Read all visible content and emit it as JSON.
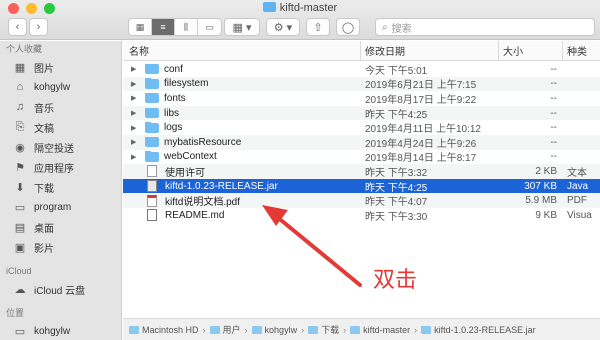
{
  "window": {
    "title": "kiftd-master"
  },
  "toolbar": {
    "back": "‹",
    "forward": "›",
    "view_icons": [
      "▦",
      "≡",
      "⫼",
      "▭"
    ],
    "group": "▦ ▾",
    "action": "⚙ ▾",
    "share": "⇧",
    "tag": "◯",
    "search_placeholder": "搜索"
  },
  "sidebar": {
    "favorites_header": "个人收藏",
    "items": [
      {
        "icon": "▦",
        "label": "图片"
      },
      {
        "icon": "⌂",
        "label": "kohgylw"
      },
      {
        "icon": "♫",
        "label": "音乐"
      },
      {
        "icon": "⎘",
        "label": "文稿"
      },
      {
        "icon": "◉",
        "label": "隔空投送"
      },
      {
        "icon": "⚑",
        "label": "应用程序"
      },
      {
        "icon": "⬇",
        "label": "下载"
      },
      {
        "icon": "▭",
        "label": "program"
      },
      {
        "icon": "▤",
        "label": "桌面"
      },
      {
        "icon": "▣",
        "label": "影片"
      }
    ],
    "icloud_header": "iCloud",
    "icloud_items": [
      {
        "icon": "☁",
        "label": "iCloud 云盘"
      }
    ],
    "locations_header": "位置",
    "location_items": [
      {
        "icon": "▭",
        "label": "kohgylw"
      }
    ]
  },
  "columns": {
    "name": "名称",
    "date": "修改日期",
    "size": "大小",
    "kind": "种类"
  },
  "files": [
    {
      "type": "folder",
      "name": "conf",
      "date": "今天 下午5:01",
      "size": "--",
      "kind": ""
    },
    {
      "type": "folder",
      "name": "filesystem",
      "date": "2019年6月21日 上午7:15",
      "size": "--",
      "kind": ""
    },
    {
      "type": "folder",
      "name": "fonts",
      "date": "2019年8月17日 上午9:22",
      "size": "--",
      "kind": ""
    },
    {
      "type": "folder",
      "name": "libs",
      "date": "昨天 下午4:25",
      "size": "--",
      "kind": ""
    },
    {
      "type": "folder",
      "name": "logs",
      "date": "2019年4月11日 上午10:12",
      "size": "--",
      "kind": ""
    },
    {
      "type": "folder",
      "name": "mybatisResource",
      "date": "2019年4月24日 上午9:26",
      "size": "--",
      "kind": ""
    },
    {
      "type": "folder",
      "name": "webContext",
      "date": "2019年8月14日 上午8:17",
      "size": "--",
      "kind": ""
    },
    {
      "type": "doc",
      "name": "使用许可",
      "date": "昨天 下午3:32",
      "size": "2 KB",
      "kind": "文本"
    },
    {
      "type": "jar",
      "name": "kiftd-1.0.23-RELEASE.jar",
      "date": "昨天 下午4:25",
      "size": "307 KB",
      "kind": "Java",
      "selected": true
    },
    {
      "type": "pdf",
      "name": "kiftd说明文档.pdf",
      "date": "昨天 下午4:07",
      "size": "5.9 MB",
      "kind": "PDF"
    },
    {
      "type": "md",
      "name": "README.md",
      "date": "昨天 下午3:30",
      "size": "9 KB",
      "kind": "Visua"
    }
  ],
  "pathbar": [
    "Macintosh HD",
    "用户",
    "kohgylw",
    "下载",
    "kiftd-master",
    "kiftd-1.0.23-RELEASE.jar"
  ],
  "annotation": {
    "text": "双击",
    "color": "#e53935"
  }
}
